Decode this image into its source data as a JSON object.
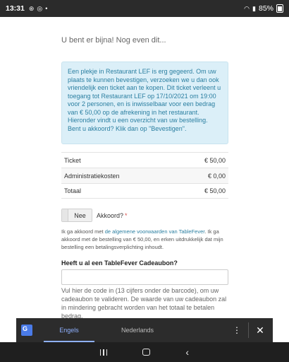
{
  "status_bar": {
    "time": "13:31",
    "battery": "85%"
  },
  "page": {
    "subtitle": "U bent er bijna! Nog even dit...",
    "info_text": "Een plekje in Restaurant LEF is erg gegeerd. Om uw plaats te kunnen bevestigen, verzoeken we u dan ook vriendelijk een ticket aan te kopen. Dit ticket verleent u toegang tot Restaurant LEF op 17/10/2021 om 19:00 voor 2 personen, en is inwisselbaar voor een bedrag van € 50,00 op de afrekening in het restaurant. Hieronder vindt u een overzicht van uw bestelling. Bent u akkoord? Klik dan op \"Bevestigen\".",
    "order": [
      {
        "label": "Ticket",
        "amount": "€ 50,00"
      },
      {
        "label": "Administratiekosten",
        "amount": "€ 0,00"
      },
      {
        "label": "Totaal",
        "amount": "€ 50,00"
      }
    ],
    "toggle_label": "Nee",
    "akkoord_label": "Akkoord?",
    "required_marker": "*",
    "terms_prefix": "Ik ga akkoord met ",
    "terms_link": "de algemene voorwaarden van TableFever",
    "terms_suffix": ". Ik ga akkoord met de bestelling van € 50,00, en erken uitdrukkelijk dat mijn bestelling een betalingsverplichting inhoudt.",
    "cadeau_title": "Heeft u al een TableFever Cadeaubon?",
    "cadeau_input_value": "",
    "cadeau_help": "Vul hier de code in (13 cijfers onder de barcode), om uw cadeaubon te valideren. De waarde van uw cadeaubon zal in mindering gebracht worden van het totaal te betalen bedrag."
  },
  "translate_bar": {
    "tab_english": "Engels",
    "tab_dutch": "Nederlands",
    "active_tab": "Engels",
    "accent_color": "#8fb1ff"
  },
  "icons": {
    "translate": "google-translate-icon",
    "more": "more-vert-icon",
    "close": "close-icon"
  }
}
